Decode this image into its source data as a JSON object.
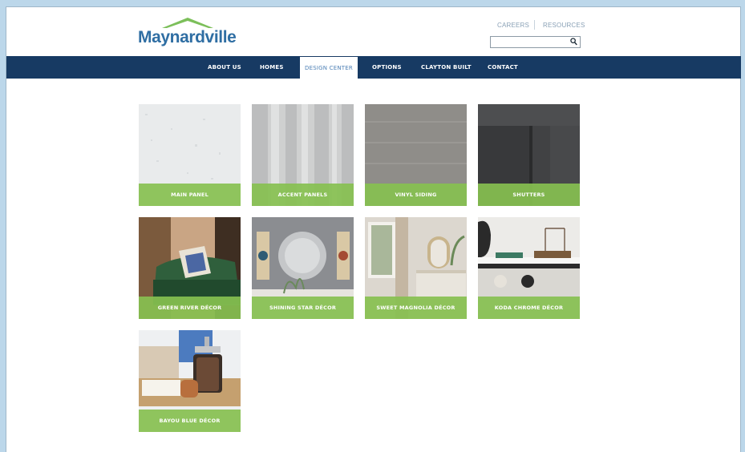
{
  "brand": {
    "name": "Maynardville",
    "logo_color": "#2f6ea3",
    "roof_color": "#7cbf5a"
  },
  "utility": {
    "careers": "CAREERS",
    "resources": "RESOURCES"
  },
  "search": {
    "placeholder": "",
    "icon": "search-icon"
  },
  "nav": {
    "background": "#173a63",
    "items": [
      "ABOUT US",
      "HOMES",
      "DESIGN CENTER",
      "OPTIONS",
      "CLAYTON BUILT",
      "CONTACT"
    ],
    "active": "DESIGN CENTER"
  },
  "tiles": [
    {
      "label": "MAIN PANEL"
    },
    {
      "label": "ACCENT PANELS"
    },
    {
      "label": "VINYL SIDING"
    },
    {
      "label": "SHUTTERS"
    },
    {
      "label": "GREEN RIVER DÉCOR"
    },
    {
      "label": "SHINING STAR DÉCOR"
    },
    {
      "label": "SWEET MAGNOLIA DÉCOR"
    },
    {
      "label": "KODA CHROME DÉCOR"
    },
    {
      "label": "BAYOU BLUE DÉCOR"
    }
  ],
  "colors": {
    "label_overlay": "#87c050",
    "page_bg": "#bcd7ea"
  }
}
